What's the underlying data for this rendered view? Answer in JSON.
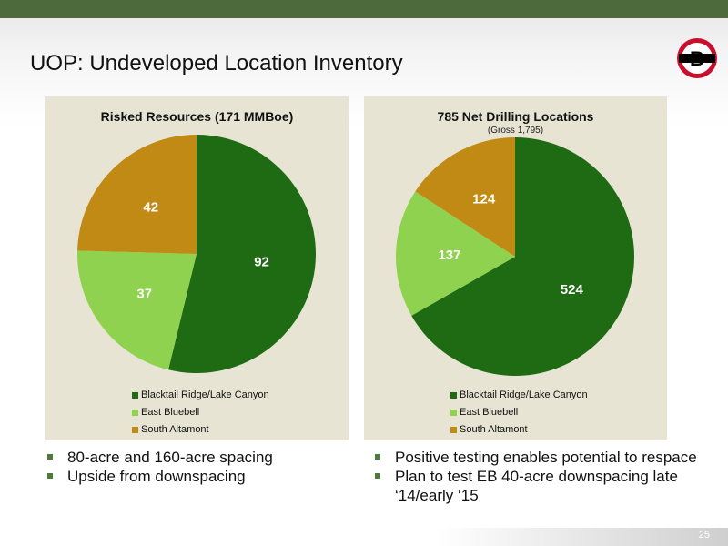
{
  "page": {
    "title": "UOP: Undeveloped Location Inventory",
    "page_number": "25",
    "logo_letter": "B"
  },
  "colors": {
    "top_bar": "#4c6a3c",
    "panel_bg": "#e8e4d4",
    "dark_green": "#1f6b14",
    "light_green": "#8fd24f",
    "gold": "#c08a14",
    "bullet": "#4e7a3e",
    "logo_red": "#c8102e"
  },
  "chart_data": [
    {
      "type": "pie",
      "title": "Risked Resources (171 MMBoe)",
      "subtitle": "",
      "categories": [
        "Blacktail Ridge/Lake Canyon",
        "East Bluebell",
        "South Altamont"
      ],
      "values": [
        92,
        37,
        42
      ],
      "labels": [
        "92",
        "37",
        "42"
      ],
      "colors": [
        "#1f6b14",
        "#8fd24f",
        "#c08a14"
      ],
      "legend": "bottom",
      "legend_entries": [
        "Blacktail Ridge/Lake Canyon",
        "East Bluebell",
        "South Altamont"
      ]
    },
    {
      "type": "pie",
      "title": "785 Net Drilling Locations",
      "subtitle": "(Gross 1,795)",
      "categories": [
        "Blacktail Ridge/Lake Canyon",
        "East Bluebell",
        "South Altamont"
      ],
      "values": [
        524,
        137,
        124
      ],
      "labels": [
        "524",
        "137",
        "124"
      ],
      "colors": [
        "#1f6b14",
        "#8fd24f",
        "#c08a14"
      ],
      "legend": "bottom",
      "legend_entries": [
        "Blacktail Ridge/Lake Canyon",
        "East Bluebell",
        "South Altamont"
      ]
    }
  ],
  "bullets_left": [
    "80-acre and 160-acre spacing",
    "Upside from downspacing"
  ],
  "bullets_right": [
    "Positive testing enables potential to respace",
    "Plan to test EB 40-acre downspacing late ‘14/early ‘15"
  ]
}
